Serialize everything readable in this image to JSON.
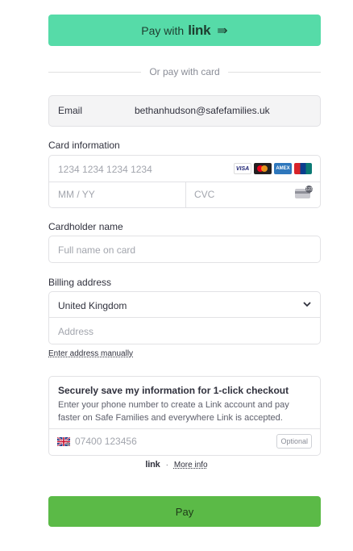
{
  "link_button": {
    "prefix": "Pay with",
    "brand": "link",
    "arrow": "⇛"
  },
  "divider": {
    "text": "Or pay with card"
  },
  "email": {
    "label": "Email",
    "value": "bethanhudson@safefamilies.uk"
  },
  "card": {
    "label": "Card information",
    "number_placeholder": "1234 1234 1234 1234",
    "expiry_placeholder": "MM / YY",
    "cvc_placeholder": "CVC",
    "brands": [
      "VISA",
      "Mastercard",
      "AMEX",
      "UnionPay"
    ],
    "cvc_icon_number": "123"
  },
  "cardholder": {
    "label": "Cardholder name",
    "placeholder": "Full name on card"
  },
  "billing": {
    "label": "Billing address",
    "country": "United Kingdom",
    "address_placeholder": "Address",
    "manual_link": "Enter address manually"
  },
  "save": {
    "title": "Securely save my information for 1-click checkout",
    "description": "Enter your phone number to create a Link account and pay faster on Safe Families and everywhere Link is accepted.",
    "phone_placeholder": "07400 123456",
    "optional_label": "Optional"
  },
  "footer": {
    "brand": "link",
    "separator": "·",
    "more_info": "More info"
  },
  "pay_button": {
    "label": "Pay"
  },
  "colors": {
    "link_green": "#56dba8",
    "pay_green": "#5bba47"
  }
}
